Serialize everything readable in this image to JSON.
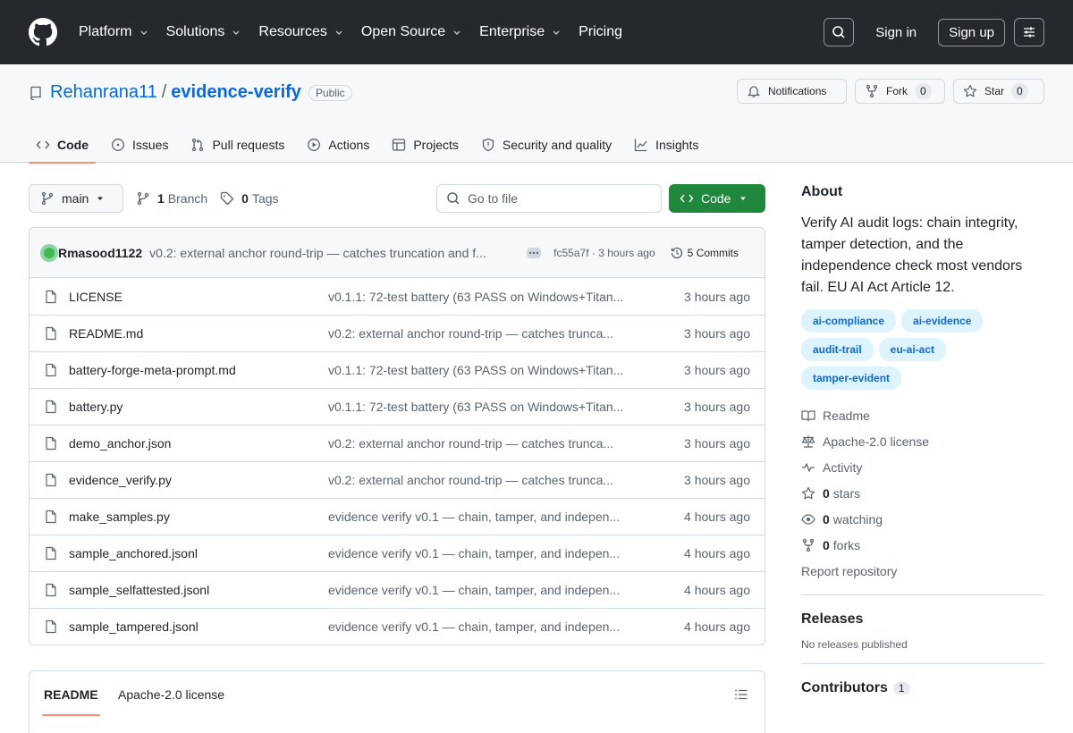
{
  "header": {
    "nav": [
      {
        "label": "Platform",
        "dropdown": true
      },
      {
        "label": "Solutions",
        "dropdown": true
      },
      {
        "label": "Resources",
        "dropdown": true
      },
      {
        "label": "Open Source",
        "dropdown": true
      },
      {
        "label": "Enterprise",
        "dropdown": true
      },
      {
        "label": "Pricing",
        "dropdown": false
      }
    ],
    "sign_in": "Sign in",
    "sign_up": "Sign up"
  },
  "repo": {
    "owner": "Rehanrana11",
    "separator": "/",
    "name": "evidence-verify",
    "visibility": "Public",
    "notifications_label": "Notifications",
    "fork_label": "Fork",
    "fork_count": "0",
    "star_label": "Star",
    "star_count": "0"
  },
  "tabs": [
    {
      "label": "Code",
      "icon": "code-icon",
      "active": true
    },
    {
      "label": "Issues",
      "icon": "issue-icon"
    },
    {
      "label": "Pull requests",
      "icon": "pull-request-icon"
    },
    {
      "label": "Actions",
      "icon": "play-icon"
    },
    {
      "label": "Projects",
      "icon": "table-icon"
    },
    {
      "label": "Security and quality",
      "icon": "shield-icon"
    },
    {
      "label": "Insights",
      "icon": "graph-icon"
    }
  ],
  "toolbar": {
    "branch": "main",
    "branch_count": "1",
    "branch_label": "Branch",
    "tag_count": "0",
    "tag_label": "Tags",
    "go_to_file_placeholder": "Go to file",
    "code_button": "Code"
  },
  "latest_commit": {
    "author": "Rmasood1122",
    "message": "v0.2: external anchor round-trip — catches truncation and f...",
    "sha": "fc55a7f",
    "age_sep": "·",
    "age": "3 hours ago",
    "commits_count": "5",
    "commits_label": "Commits"
  },
  "files": [
    {
      "name": "LICENSE",
      "message": "v0.1.1: 72-test battery (63 PASS on Windows+Titan...",
      "age": "3 hours ago"
    },
    {
      "name": "README.md",
      "message": "v0.2: external anchor round-trip — catches trunca...",
      "age": "3 hours ago"
    },
    {
      "name": "battery-forge-meta-prompt.md",
      "message": "v0.1.1: 72-test battery (63 PASS on Windows+Titan...",
      "age": "3 hours ago"
    },
    {
      "name": "battery.py",
      "message": "v0.1.1: 72-test battery (63 PASS on Windows+Titan...",
      "age": "3 hours ago"
    },
    {
      "name": "demo_anchor.json",
      "message": "v0.2: external anchor round-trip — catches trunca...",
      "age": "3 hours ago"
    },
    {
      "name": "evidence_verify.py",
      "message": "v0.2: external anchor round-trip — catches trunca...",
      "age": "3 hours ago"
    },
    {
      "name": "make_samples.py",
      "message": "evidence verify v0.1 — chain, tamper, and indepen...",
      "age": "4 hours ago"
    },
    {
      "name": "sample_anchored.jsonl",
      "message": "evidence verify v0.1 — chain, tamper, and indepen...",
      "age": "4 hours ago"
    },
    {
      "name": "sample_selfattested.jsonl",
      "message": "evidence verify v0.1 — chain, tamper, and indepen...",
      "age": "4 hours ago"
    },
    {
      "name": "sample_tampered.jsonl",
      "message": "evidence verify v0.1 — chain, tamper, and indepen...",
      "age": "4 hours ago"
    }
  ],
  "readme": {
    "tab_readme": "README",
    "tab_license": "Apache-2.0 license"
  },
  "about": {
    "heading": "About",
    "description": "Verify AI audit logs: chain integrity, tamper detection, and the independence check most vendors fail. EU AI Act Article 12.",
    "topics": [
      "ai-compliance",
      "ai-evidence",
      "audit-trail",
      "eu-ai-act",
      "tamper-evident"
    ],
    "readme": "Readme",
    "license": "Apache-2.0 license",
    "activity": "Activity",
    "stars_count": "0",
    "stars_label": "stars",
    "watching_count": "0",
    "watching_label": "watching",
    "forks_count": "0",
    "forks_label": "forks",
    "report": "Report repository"
  },
  "releases": {
    "heading": "Releases",
    "empty": "No releases published"
  },
  "contributors": {
    "heading": "Contributors",
    "count": "1"
  },
  "colors": {
    "header_bg": "#25292e",
    "link": "#0969da",
    "primary_button": "#1f883d",
    "tab_underline": "#fd8c73",
    "topic_bg": "#ddf4ff"
  }
}
